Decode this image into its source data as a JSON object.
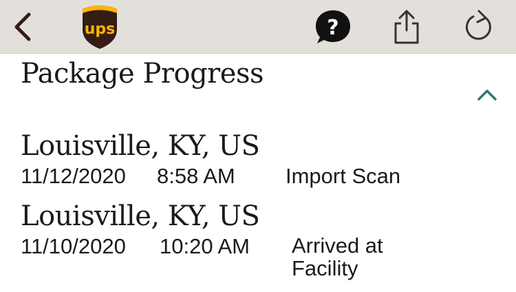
{
  "colors": {
    "topbar_bg": "#e3e0dc",
    "brand_brown": "#351c15",
    "brand_gold": "#ffb500",
    "accent_teal": "#2d7a73"
  },
  "toolbar": {
    "back_icon": "chevron-left-icon",
    "logo_text": "ups",
    "help_icon": "question-bubble-icon",
    "share_icon": "share-icon",
    "refresh_icon": "refresh-icon"
  },
  "progress": {
    "title": "Package Progress",
    "collapse_icon": "chevron-up-icon",
    "events": [
      {
        "location": "Louisville, KY, US",
        "date": "11/12/2020",
        "time": "8:58 AM",
        "description": "Import Scan"
      },
      {
        "location": "Louisville, KY, US",
        "date": "11/10/2020",
        "time": "10:20 AM",
        "description": "Arrived at Facility"
      }
    ]
  }
}
